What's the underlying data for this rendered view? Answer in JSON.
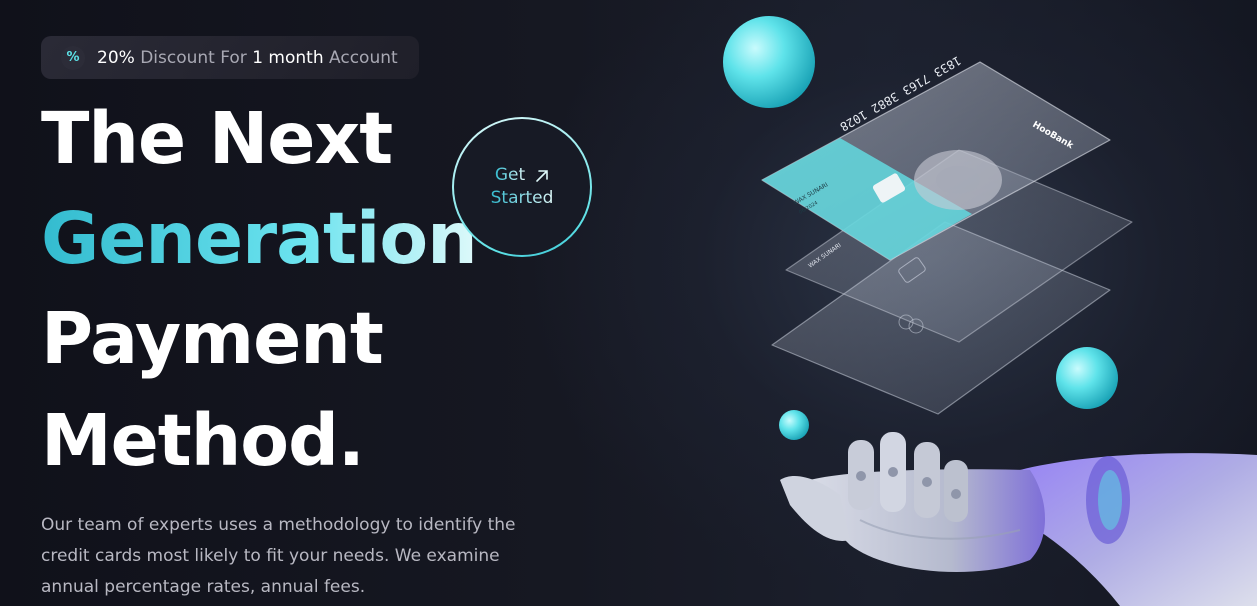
{
  "badge": {
    "icon": "discount-icon",
    "parts": [
      "20%",
      " Discount For ",
      "1 month",
      " Account"
    ]
  },
  "heading": {
    "line1": "The Next",
    "line2": "Generation",
    "line3": "Payment",
    "line4": "Method."
  },
  "cta": {
    "word1": "Get",
    "word2": "Started",
    "icon": "arrow-up-right-icon"
  },
  "description": "Our team of experts uses a methodology to identify the credit cards most likely to fit your needs. We examine annual percentage rates, annual fees.",
  "illustration": {
    "card_brand": "HooBank",
    "card_number": "1833 7163 3882 1028",
    "card_holder": "WAX SUNARI",
    "card_date": "06/2024"
  },
  "colors": {
    "accent": "#5ce1e6",
    "accent_dark": "#33bbcf",
    "background": "#00040f",
    "text_dim": "#b8b8c2"
  }
}
